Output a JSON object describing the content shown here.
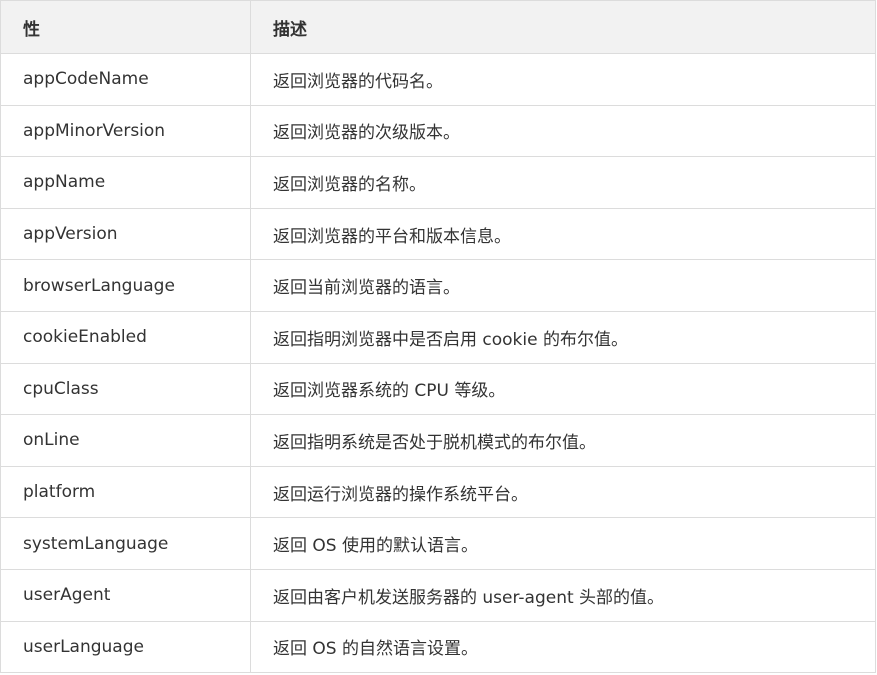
{
  "header": {
    "property": "性",
    "description": "描述"
  },
  "rows": [
    {
      "property": "appCodeName",
      "description": "返回浏览器的代码名。"
    },
    {
      "property": "appMinorVersion",
      "description": "返回浏览器的次级版本。"
    },
    {
      "property": "appName",
      "description": "返回浏览器的名称。"
    },
    {
      "property": "appVersion",
      "description": "返回浏览器的平台和版本信息。"
    },
    {
      "property": "browserLanguage",
      "description": "返回当前浏览器的语言。"
    },
    {
      "property": "cookieEnabled",
      "description": "返回指明浏览器中是否启用 cookie 的布尔值。"
    },
    {
      "property": "cpuClass",
      "description": "返回浏览器系统的 CPU 等级。"
    },
    {
      "property": "onLine",
      "description": "返回指明系统是否处于脱机模式的布尔值。"
    },
    {
      "property": "platform",
      "description": "返回运行浏览器的操作系统平台。"
    },
    {
      "property": "systemLanguage",
      "description": "返回 OS 使用的默认语言。"
    },
    {
      "property": "userAgent",
      "description": "返回由客户机发送服务器的 user-agent 头部的值。"
    },
    {
      "property": "userLanguage",
      "description": "返回 OS 的自然语言设置。"
    }
  ]
}
